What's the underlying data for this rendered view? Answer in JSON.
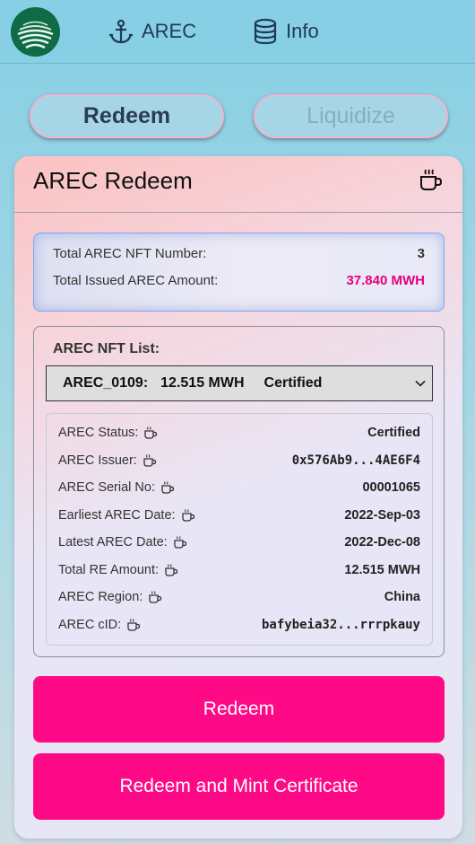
{
  "header": {
    "nav": [
      {
        "label": "AREC",
        "icon": "anchor-icon"
      },
      {
        "label": "Info",
        "icon": "database-icon"
      }
    ]
  },
  "modes": {
    "redeem": "Redeem",
    "liquidize": "Liquidize",
    "active": "redeem"
  },
  "card": {
    "title": "AREC Redeem",
    "summary": {
      "nft_number_label": "Total AREC NFT Number:",
      "nft_number_value": "3",
      "issued_amount_label": "Total Issued AREC Amount:",
      "issued_amount_value": "37.840 MWH"
    },
    "nft_list": {
      "title": "AREC NFT List:",
      "selected": {
        "id": "AREC_0109:",
        "amount": "12.515 MWH",
        "status": "Certified"
      }
    },
    "details": [
      {
        "label": "AREC Status:",
        "value": "Certified"
      },
      {
        "label": "AREC Issuer:",
        "value": "0x576Ab9...4AE6F4"
      },
      {
        "label": "AREC Serial No:",
        "value": "00001065"
      },
      {
        "label": "Earliest AREC Date:",
        "value": "2022-Sep-03"
      },
      {
        "label": "Latest AREC Date:",
        "value": "2022-Dec-08"
      },
      {
        "label": "Total RE Amount:",
        "value": "12.515 MWH"
      },
      {
        "label": "AREC Region:",
        "value": "China"
      },
      {
        "label": "AREC cID:",
        "value": "bafybeia32...rrrpkauy"
      }
    ],
    "buttons": {
      "redeem": "Redeem",
      "redeem_mint": "Redeem and Mint Certificate"
    }
  },
  "colors": {
    "accent_pink": "#ff0a86",
    "amount_pink": "#e6007a",
    "header_bg": "#87cfe4"
  }
}
